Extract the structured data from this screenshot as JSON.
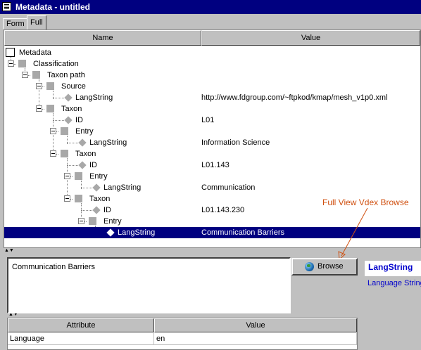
{
  "window": {
    "title": "Metadata - untitled"
  },
  "tabs": [
    {
      "label": "Form"
    },
    {
      "label": "Full"
    }
  ],
  "tree": {
    "columns": {
      "name": "Name",
      "value": "Value"
    },
    "root": "Metadata",
    "rows": [
      {
        "label": "Classification",
        "value": ""
      },
      {
        "label": "Taxon path",
        "value": ""
      },
      {
        "label": "Source",
        "value": ""
      },
      {
        "label": "LangString",
        "value": "http://www.fdgroup.com/~ftpkod/kmap/mesh_v1p0.xml"
      },
      {
        "label": "Taxon",
        "value": ""
      },
      {
        "label": "ID",
        "value": "L01"
      },
      {
        "label": "Entry",
        "value": ""
      },
      {
        "label": "LangString",
        "value": "Information Science"
      },
      {
        "label": "Taxon",
        "value": ""
      },
      {
        "label": "ID",
        "value": "L01.143"
      },
      {
        "label": "Entry",
        "value": ""
      },
      {
        "label": "LangString",
        "value": "Communication"
      },
      {
        "label": "Taxon",
        "value": ""
      },
      {
        "label": "ID",
        "value": "L01.143.230"
      },
      {
        "label": "Entry",
        "value": ""
      },
      {
        "label": "LangString",
        "value": "Communication Barriers"
      }
    ]
  },
  "editor": {
    "text": "Communication Barriers"
  },
  "browse": {
    "label": "Browse"
  },
  "info": {
    "title": "LangString",
    "description": "Language String"
  },
  "attributes": {
    "columns": {
      "attribute": "Attribute",
      "value": "Value"
    },
    "rows": [
      {
        "attribute": "Language",
        "value": "en"
      }
    ]
  },
  "annotation": {
    "text": "Full View Vdex Browse",
    "color": "#d05010"
  },
  "colors": {
    "titlebar": "#000080",
    "selection": "#000080",
    "info_text": "#0000cc"
  }
}
